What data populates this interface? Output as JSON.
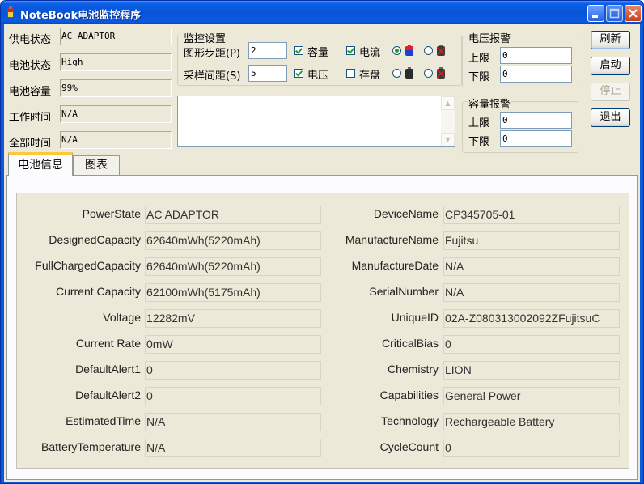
{
  "window": {
    "title": "NoteBook电池监控程序"
  },
  "status": {
    "rows": [
      {
        "label": "供电状态",
        "value": "AC ADAPTOR"
      },
      {
        "label": "电池状态",
        "value": "High"
      },
      {
        "label": "电池容量",
        "value": "99%"
      },
      {
        "label": "工作时间",
        "value": "N/A"
      },
      {
        "label": "全部时间",
        "value": "N/A"
      }
    ]
  },
  "monitor": {
    "title": "监控设置",
    "graph_step_label": "图形步距(P)",
    "graph_step_value": "2",
    "sample_interval_label": "采样间距(S)",
    "sample_interval_value": "5",
    "capacity_label": "容量",
    "voltage_label": "电压",
    "current_label": "电流",
    "save_label": "存盘",
    "capacity_checked": true,
    "voltage_checked": true,
    "current_checked": true,
    "save_checked": false
  },
  "voltage_alarm": {
    "title": "电压报警",
    "upper_label": "上限",
    "upper_value": "0",
    "lower_label": "下限",
    "lower_value": "0"
  },
  "capacity_alarm": {
    "title": "容量报警",
    "upper_label": "上限",
    "upper_value": "0",
    "lower_label": "下限",
    "lower_value": "0"
  },
  "buttons": {
    "refresh": "刷新",
    "start": "启动",
    "stop": "停止",
    "exit": "退出"
  },
  "tabs": [
    {
      "label": "电池信息"
    },
    {
      "label": "图表"
    }
  ],
  "battery_info": {
    "left": [
      {
        "label": "PowerState",
        "value": "AC ADAPTOR"
      },
      {
        "label": "DesignedCapacity",
        "value": "62640mWh(5220mAh)"
      },
      {
        "label": "FullChargedCapacity",
        "value": "62640mWh(5220mAh)"
      },
      {
        "label": "Current Capacity",
        "value": "62100mWh(5175mAh)"
      },
      {
        "label": "Voltage",
        "value": "12282mV"
      },
      {
        "label": "Current Rate",
        "value": "0mW"
      },
      {
        "label": "DefaultAlert1",
        "value": "0"
      },
      {
        "label": "DefaultAlert2",
        "value": "0"
      },
      {
        "label": "EstimatedTime",
        "value": "N/A"
      },
      {
        "label": "BatteryTemperature",
        "value": "N/A"
      }
    ],
    "right": [
      {
        "label": "DeviceName",
        "value": "CP345705-01"
      },
      {
        "label": "ManufactureName",
        "value": "Fujitsu"
      },
      {
        "label": "ManufactureDate",
        "value": "N/A"
      },
      {
        "label": "SerialNumber",
        "value": "N/A"
      },
      {
        "label": "UniqueID",
        "value": "02A-Z080313002092ZFujitsuC"
      },
      {
        "label": "CriticalBias",
        "value": "0"
      },
      {
        "label": "Chemistry",
        "value": "LION"
      },
      {
        "label": "Capabilities",
        "value": "General Power"
      },
      {
        "label": "Technology",
        "value": "Rechargeable Battery"
      },
      {
        "label": "CycleCount",
        "value": "0"
      }
    ]
  }
}
